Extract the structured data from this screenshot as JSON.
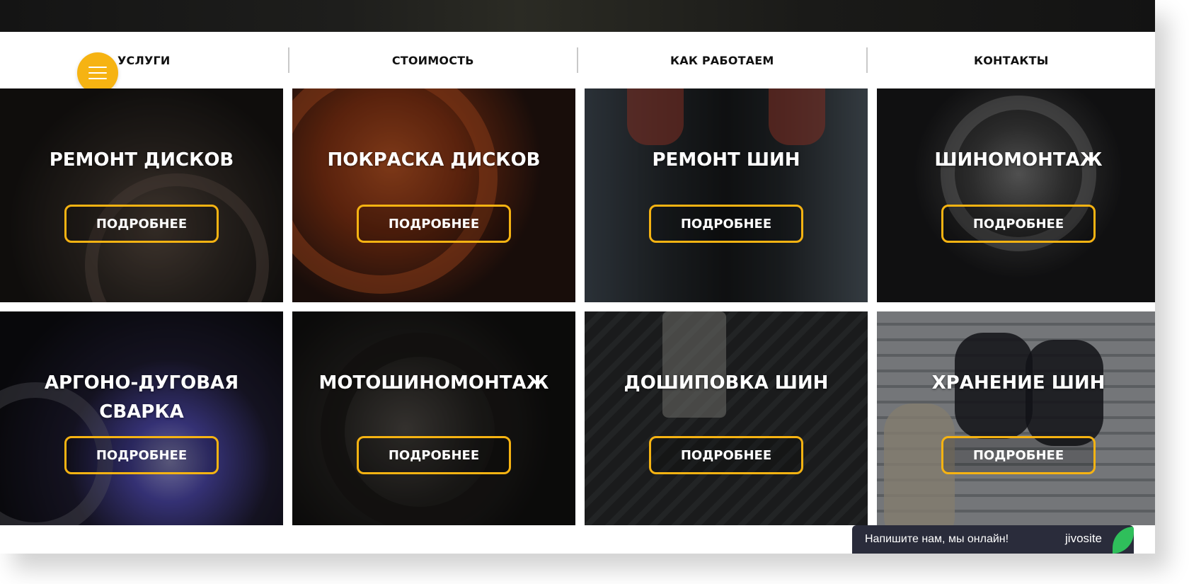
{
  "nav": {
    "items": [
      {
        "label": "УСЛУГИ"
      },
      {
        "label": "СТОИМОСТЬ"
      },
      {
        "label": "КАК РАБОТАЕМ"
      },
      {
        "label": "КОНТАКТЫ"
      }
    ],
    "menu_icon": "hamburger-menu-icon"
  },
  "services": [
    {
      "title": "РЕМОНТ ДИСКОВ",
      "button": "ПОДРОБНЕЕ"
    },
    {
      "title": "ПОКРАСКА ДИСКОВ",
      "button": "ПОДРОБНЕЕ"
    },
    {
      "title": "РЕМОНТ ШИН",
      "button": "ПОДРОБНЕЕ"
    },
    {
      "title": "ШИНОМОНТАЖ",
      "button": "ПОДРОБНЕЕ"
    },
    {
      "title": "АРГОНО-ДУГОВАЯ СВАРКА",
      "button": "ПОДРОБНЕЕ"
    },
    {
      "title": "МОТОШИНОМОНТАЖ",
      "button": "ПОДРОБНЕЕ"
    },
    {
      "title": "ДОШИПОВКА ШИН",
      "button": "ПОДРОБНЕЕ"
    },
    {
      "title": "ХРАНЕНИЕ ШИН",
      "button": "ПОДРОБНЕЕ"
    }
  ],
  "chat": {
    "text": "Напишите нам, мы онлайн!",
    "brand": "jivosite"
  },
  "colors": {
    "accent": "#f6b312",
    "chat_bg": "#2a2c3b",
    "chat_leaf": "#2fbf5b"
  }
}
